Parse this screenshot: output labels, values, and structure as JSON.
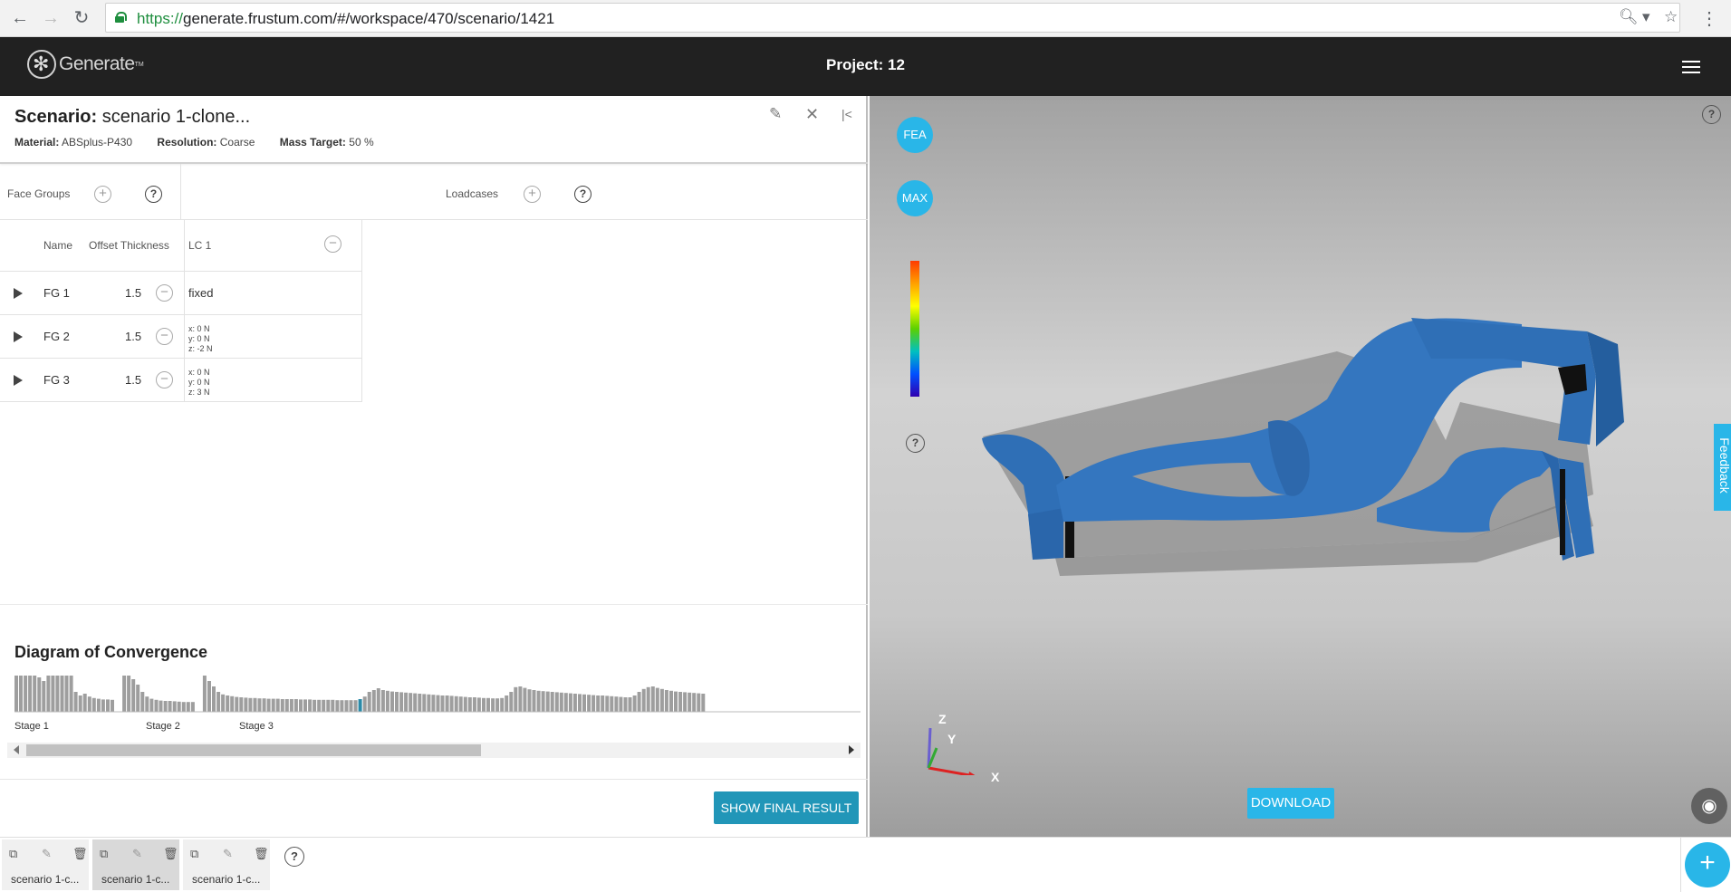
{
  "browser": {
    "url_scheme": "https://",
    "url_rest": "generate.frustum.com/#/workspace/470/scenario/1421"
  },
  "app": {
    "logo_text": "Generate",
    "logo_tm": "TM",
    "project_title": "Project: 12"
  },
  "scenario": {
    "label": "Scenario:",
    "name": "scenario 1-clone...",
    "material_label": "Material:",
    "material": "ABSplus-P430",
    "resolution_label": "Resolution:",
    "resolution": "Coarse",
    "mass_label": "Mass Target:",
    "mass": "50 %"
  },
  "sections": {
    "face_groups": "Face Groups",
    "loadcases": "Loadcases",
    "plus": "+",
    "help": "?"
  },
  "table": {
    "col_name": "Name",
    "col_offset": "Offset Thickness",
    "col_lc": "LC 1",
    "minus": "−",
    "rows": [
      {
        "name": "FG 1",
        "offset": "1.5",
        "lc": "fixed"
      },
      {
        "name": "FG 2",
        "offset": "1.5",
        "lc_x": "x: 0 N",
        "lc_y": "y: 0 N",
        "lc_z": "z: -2 N"
      },
      {
        "name": "FG 3",
        "offset": "1.5",
        "lc_x": "x: 0 N",
        "lc_y": "y: 0 N",
        "lc_z": "z: 3 N"
      }
    ]
  },
  "convergence": {
    "title": "Diagram of Convergence",
    "stages": [
      "Stage 1",
      "Stage 2",
      "Stage 3"
    ],
    "show_final": "SHOW FINAL RESULT"
  },
  "chart_data": {
    "type": "bar",
    "title": "Diagram of Convergence",
    "stages": [
      {
        "name": "Stage 1",
        "values": [
          1.0,
          1.0,
          1.0,
          1.0,
          1.0,
          0.95,
          0.85,
          1.0,
          1.0,
          1.0,
          1.0,
          1.0,
          1.0,
          0.55,
          0.45,
          0.5,
          0.42,
          0.38,
          0.36,
          0.34,
          0.34,
          0.33
        ]
      },
      {
        "name": "Stage 2",
        "values": [
          1.0,
          1.0,
          0.9,
          0.75,
          0.55,
          0.42,
          0.36,
          0.33,
          0.31,
          0.3,
          0.3,
          0.29,
          0.28,
          0.27,
          0.27,
          0.27
        ]
      },
      {
        "name": "Stage 3",
        "values": [
          1.0,
          0.85,
          0.7,
          0.55,
          0.48,
          0.45,
          0.43,
          0.41,
          0.4,
          0.39,
          0.38,
          0.38,
          0.37,
          0.37,
          0.36,
          0.36,
          0.36,
          0.35,
          0.35,
          0.35,
          0.35,
          0.34,
          0.34,
          0.34,
          0.33,
          0.33,
          0.33,
          0.33,
          0.33,
          0.32,
          0.32,
          0.32,
          0.32,
          0.32,
          0.35,
          0.42,
          0.55,
          0.6,
          0.65,
          0.6,
          0.58,
          0.56,
          0.55,
          0.54,
          0.53,
          0.52,
          0.51,
          0.5,
          0.49,
          0.48,
          0.47,
          0.46,
          0.45,
          0.45,
          0.44,
          0.43,
          0.42,
          0.41,
          0.4,
          0.4,
          0.39,
          0.38,
          0.38,
          0.37,
          0.37,
          0.38,
          0.45,
          0.55,
          0.68,
          0.7,
          0.66,
          0.62,
          0.6,
          0.58,
          0.57,
          0.56,
          0.55,
          0.54,
          0.53,
          0.52,
          0.51,
          0.5,
          0.49,
          0.48,
          0.47,
          0.46,
          0.45,
          0.45,
          0.44,
          0.43,
          0.42,
          0.41,
          0.4,
          0.4,
          0.45,
          0.55,
          0.63,
          0.68,
          0.7,
          0.66,
          0.63,
          0.6,
          0.58,
          0.56,
          0.55,
          0.54,
          0.53,
          0.52,
          0.51,
          0.5
        ]
      }
    ],
    "highlight": {
      "stage": "Stage 3",
      "index": 34
    },
    "ylim": [
      0,
      1
    ],
    "colors": {
      "bar": "#9e9e9e",
      "highlight": "#2a8aa8"
    }
  },
  "viewer": {
    "fea": "FEA",
    "max": "MAX",
    "help": "?",
    "download": "DOWNLOAD",
    "feedback": "Feedback",
    "axis_x": "X",
    "axis_y": "Y",
    "axis_z": "Z"
  },
  "bottom_tabs": [
    {
      "label": "scenario 1-c..."
    },
    {
      "label": "scenario 1-c..."
    },
    {
      "label": "scenario 1-c..."
    }
  ],
  "bottom": {
    "help": "?",
    "add": "+"
  }
}
